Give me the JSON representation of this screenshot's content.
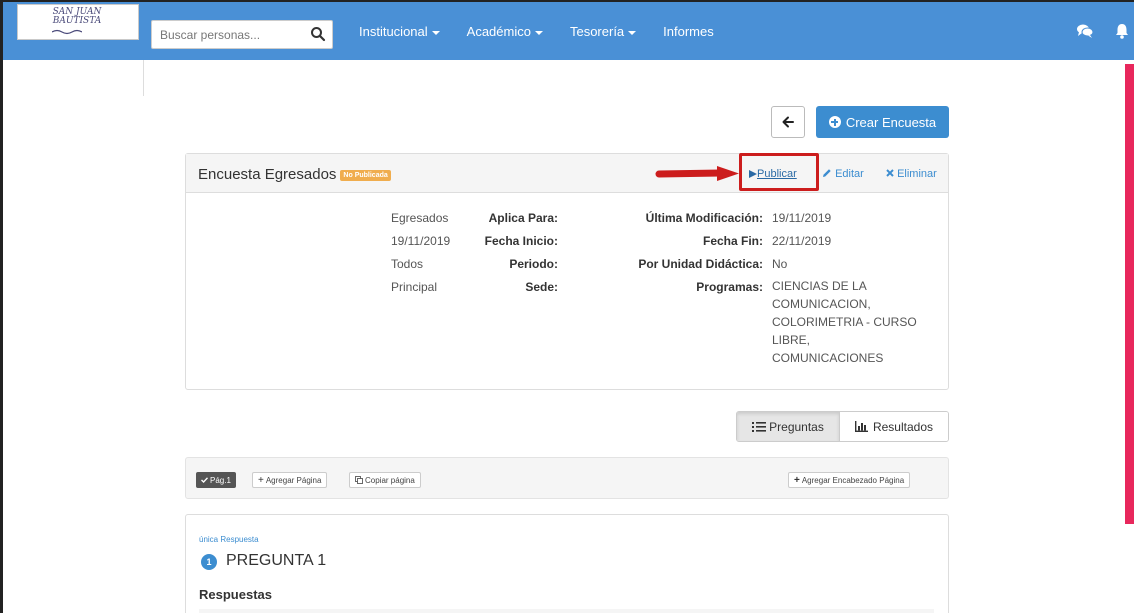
{
  "brand": {
    "logo_text": "SAN JUAN BAUTISTA"
  },
  "navbar": {
    "search_placeholder": "Buscar personas...",
    "menu": [
      {
        "label": "Institucional",
        "dropdown": true
      },
      {
        "label": "Académico",
        "dropdown": true
      },
      {
        "label": "Tesorería",
        "dropdown": true
      },
      {
        "label": "Informes",
        "dropdown": false
      }
    ],
    "icons": [
      "comments-icon",
      "bell-icon"
    ],
    "color": "#4a90d6"
  },
  "actions": {
    "back_icon": "arrow-left-icon",
    "create_label": "Crear Encuesta",
    "create_color": "#3c8dd0"
  },
  "survey": {
    "title": "Encuesta Egresados",
    "status_badge": "No Publicada",
    "badge_color": "#f0ad4e",
    "publish_label": "Publicar",
    "edit_label": "Editar",
    "delete_label": "Eliminar",
    "fields_left": [
      {
        "label": "Aplica Para:",
        "value": "Egresados"
      },
      {
        "label": "Fecha Inicio:",
        "value": "19/11/2019"
      },
      {
        "label": "Periodo:",
        "value": "Todos"
      },
      {
        "label": "Sede:",
        "value": "Principal"
      }
    ],
    "fields_right": [
      {
        "label": "Última Modificación:",
        "value": "19/11/2019"
      },
      {
        "label": "Fecha Fin:",
        "value": "22/11/2019"
      },
      {
        "label": "Por Unidad Didáctica:",
        "value": "No"
      },
      {
        "label": "Programas:",
        "value_lines": [
          "CIENCIAS DE LA",
          "COMUNICACION,",
          "COLORIMETRIA - CURSO",
          "LIBRE,",
          "COMUNICACIONES"
        ]
      }
    ],
    "highlight_color": "#cc1d1d"
  },
  "tabs": {
    "questions_label": "Preguntas",
    "results_label": "Resultados",
    "active": "Preguntas"
  },
  "page_toolbar": {
    "page_label": "Pág.1",
    "add_page_label": "Agregar Página",
    "copy_page_label": "Copiar página",
    "add_header_label": "Agregar Encabezado Página"
  },
  "question": {
    "type_label": "única Respuesta",
    "number": "1",
    "title": "PREGUNTA 1",
    "answers_label": "Respuestas"
  },
  "accent_right_bar": "#e8275c"
}
